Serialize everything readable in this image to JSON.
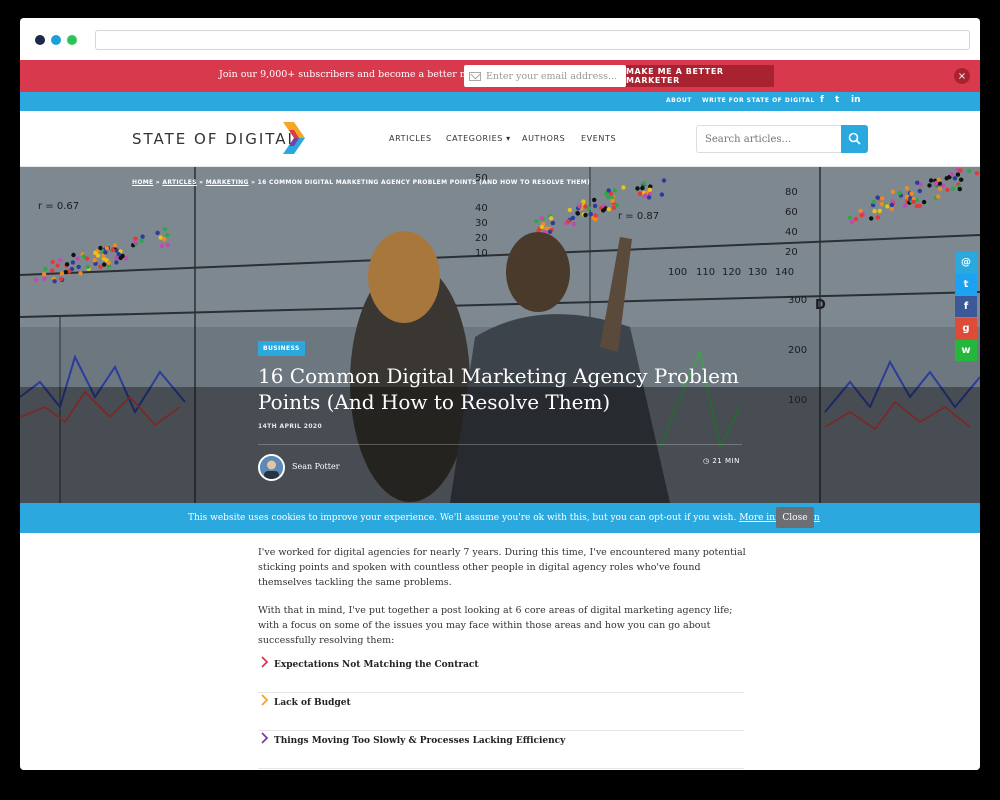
{
  "newsletter": {
    "text": "Join our 9,000+ subscribers and become a better marketer!",
    "email_placeholder": "Enter your email address...",
    "button_label": "MAKE ME A BETTER MARKETER",
    "close_label": "×"
  },
  "topbar": {
    "links": [
      "ABOUT",
      "WRITE FOR STATE OF DIGITAL"
    ],
    "social": [
      "f",
      "t",
      "in"
    ]
  },
  "header": {
    "logo": "STATE OF DIGITAL",
    "nav": [
      "ARTICLES",
      "CATEGORIES ▾",
      "AUTHORS",
      "EVENTS"
    ],
    "search_placeholder": "Search articles..."
  },
  "hero": {
    "breadcrumb": {
      "home": "HOME",
      "sep": " » ",
      "articles": "ARTICLES",
      "marketing": "MARKETING",
      "current": "16 COMMON DIGITAL MARKETING AGENCY PROBLEM POINTS (AND HOW TO RESOLVE THEM)"
    },
    "badge": "BUSINESS",
    "title": "16 Common Digital Marketing Agency Problem Points (And How to Resolve Them)",
    "date": "14TH APRIL 2020",
    "author": "Sean Potter",
    "read_time": "21 MIN",
    "chart_labels": {
      "r_left": "r = 0.67",
      "r_right": "r = 0.87",
      "axis": [
        "50",
        "40",
        "30",
        "20",
        "10",
        "100",
        "110",
        "120",
        "130",
        "140"
      ],
      "axis_right": [
        "80",
        "60",
        "40",
        "20"
      ],
      "axis_right2": [
        "300",
        "200",
        "100"
      ],
      "panel_d": "D"
    }
  },
  "share": [
    "@",
    "t",
    "f",
    "g",
    "w"
  ],
  "colors": {
    "red": "#d9394d",
    "blue": "#2ba8dd",
    "dark_red": "#a8232f"
  },
  "cookie": {
    "text": "This website uses cookies to improve your experience. We'll assume you're ok with this, but you can opt-out if you wish.",
    "link": "More information",
    "close": "Close"
  },
  "article": {
    "p1": "I've worked for digital agencies for nearly 7 years. During this time, I've encountered many potential sticking points and spoken with countless other people in digital agency roles who've found themselves tackling the same problems.",
    "p2": "With that in mind, I've put together a post looking at 6 core areas of digital marketing agency life; with a focus on some of the issues you may face within those areas and how you can go about successfully resolving them:",
    "toc": [
      "Expectations Not Matching the Contract",
      "Lack of Budget",
      "Things Moving Too Slowly & Processes Lacking Efficiency"
    ]
  }
}
